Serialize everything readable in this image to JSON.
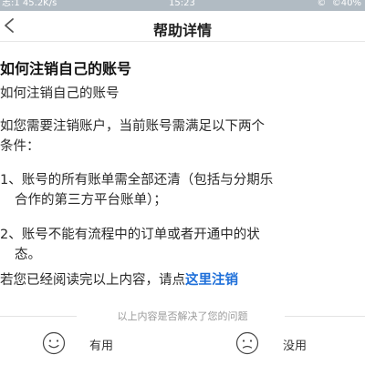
{
  "status_bar": {
    "left": "志:1 45.2K/s",
    "time": "15:23",
    "right": "©  ©40%"
  },
  "navbar": {
    "title": "帮助详情",
    "back_icon": "chevron-left-icon"
  },
  "article": {
    "heading": "如何注销自己的账号",
    "p1": "如何注销自己的账号",
    "p2_line1": "如您需要注销账户，当前账号需满足以下两个",
    "p2_line2": "条件：",
    "item1_line1": "1、账号的所有账单需全部还清（包括与分期乐",
    "item1_line2": "合作的第三方平台账单）；",
    "item2_line1": "2、账号不能有流程中的订单或者开通中的状",
    "item2_line2": "态。",
    "confirm_prefix": "若您已经阅读完以上内容，请点",
    "confirm_link": "这里注销"
  },
  "feedback": {
    "question": "以上内容是否解决了您的问题",
    "yes_label": "有用",
    "no_label": "没用",
    "yes_icon": "smile-face-icon",
    "no_icon": "frown-face-icon"
  },
  "colors": {
    "link": "#1e6fd9",
    "divider": "#e3e3e3",
    "status_bar": "#a9b4bd"
  }
}
